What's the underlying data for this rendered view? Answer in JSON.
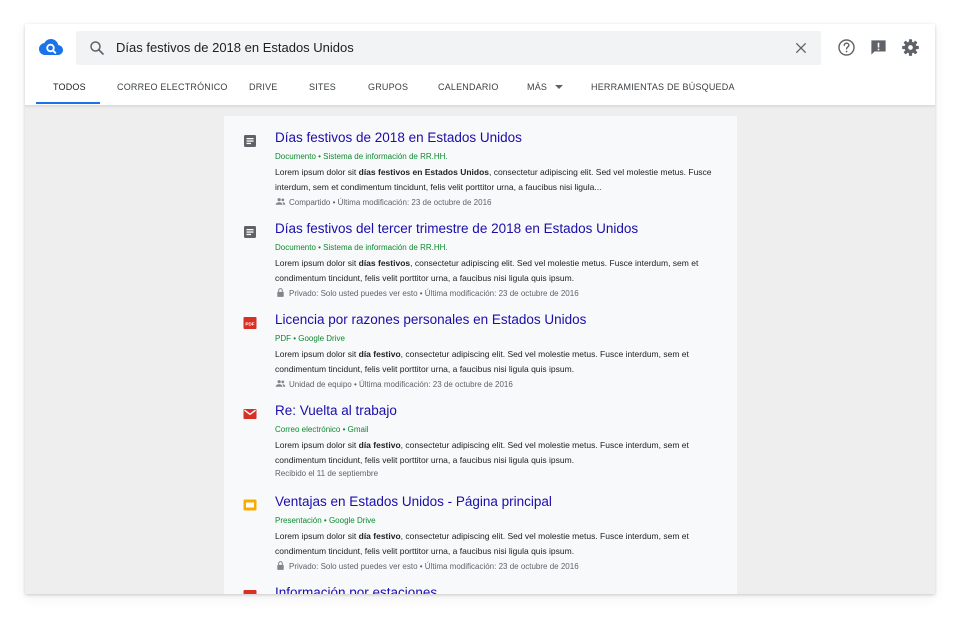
{
  "search": {
    "query": "Días festivos de 2018 en Estados Unidos"
  },
  "tabs": [
    {
      "label": "TODOS"
    },
    {
      "label": "CORREO ELECTRÓNICO"
    },
    {
      "label": "DRIVE"
    },
    {
      "label": "SITES"
    },
    {
      "label": "GRUPOS"
    },
    {
      "label": "CALENDARIO"
    },
    {
      "label": "MÁS"
    },
    {
      "label": "HERRAMIENTAS DE BÚSQUEDA"
    }
  ],
  "colors": {
    "accent": "#1a73e8",
    "link": "#1a0dab",
    "meta_green": "#0d8a2f",
    "pdf_red": "#d93025",
    "slides_yellow": "#f9ab00"
  },
  "results": [
    {
      "icon": "doc-icon",
      "title": "Días festivos de 2018 en Estados Unidos",
      "meta": "Documento • Sistema de información de RR.HH.",
      "snippet_pre": "Lorem ipsum dolor sit ",
      "snippet_bold": "días festivos en Estados Unidos",
      "snippet_post": ", consectetur adipiscing elit. Sed vel molestie metus. Fusce interdum, sem et condimentum tincidunt, felis velit porttitor urna, a faucibus nisi ligula...",
      "foot_icon": "shared-icon",
      "footer": "Compartido • Última modificación: 23 de octubre de 2016"
    },
    {
      "icon": "doc-icon",
      "title": "Días festivos del tercer trimestre de 2018 en Estados Unidos",
      "meta": "Documento • Sistema de información de RR.HH.",
      "snippet_pre": "Lorem ipsum dolor sit ",
      "snippet_bold": "días festivos",
      "snippet_post": ", consectetur adipiscing elit. Sed vel molestie metus. Fusce interdum, sem et condimentum tincidunt, felis velit porttitor urna, a faucibus nisi ligula quis ipsum.",
      "foot_icon": "lock-icon",
      "footer": "Privado: Solo usted puedes ver esto • Última modificación: 23 de octubre de 2016"
    },
    {
      "icon": "pdf-icon",
      "icon_text": "PDF",
      "title": "Licencia por razones personales en Estados Unidos",
      "meta": "PDF • Google Drive",
      "snippet_pre": "Lorem ipsum dolor sit ",
      "snippet_bold": "día festivo",
      "snippet_post": ", consectetur adipiscing elit. Sed vel molestie metus. Fusce interdum, sem et condimentum tincidunt, felis velit porttitor urna, a faucibus nisi ligula quis ipsum.",
      "foot_icon": "shared-icon",
      "footer": "Unidad de equipo • Última modificación: 23 de octubre de 2016"
    },
    {
      "icon": "mail-icon",
      "title": "Re: Vuelta al trabajo",
      "meta": "Correo electrónico • Gmail",
      "snippet_pre": "Lorem ipsum dolor sit ",
      "snippet_bold": "día festivo",
      "snippet_post": ", consectetur adipiscing elit. Sed vel molestie metus. Fusce interdum, sem et condimentum tincidunt, felis velit porttitor urna, a faucibus nisi ligula quis ipsum.",
      "foot_icon": "",
      "footer": "Recibido el 11 de septiembre"
    },
    {
      "icon": "slides-icon",
      "title": "Ventajas en Estados Unidos - Página principal",
      "meta": "Presentación • Google Drive",
      "snippet_pre": "Lorem ipsum dolor sit ",
      "snippet_bold": "día festivo",
      "snippet_post": ", consectetur adipiscing elit. Sed vel molestie metus. Fusce interdum, sem et condimentum tincidunt, felis velit porttitor urna, a faucibus nisi ligula quis ipsum.",
      "foot_icon": "lock-icon",
      "footer": "Privado: Solo usted puedes ver esto • Última modificación: 23 de octubre de 2016"
    },
    {
      "icon": "pdf-icon",
      "icon_text": "PDF",
      "title": "Información por estaciones",
      "meta": "",
      "snippet_pre": "",
      "snippet_bold": "",
      "snippet_post": "",
      "foot_icon": "",
      "footer": ""
    }
  ]
}
